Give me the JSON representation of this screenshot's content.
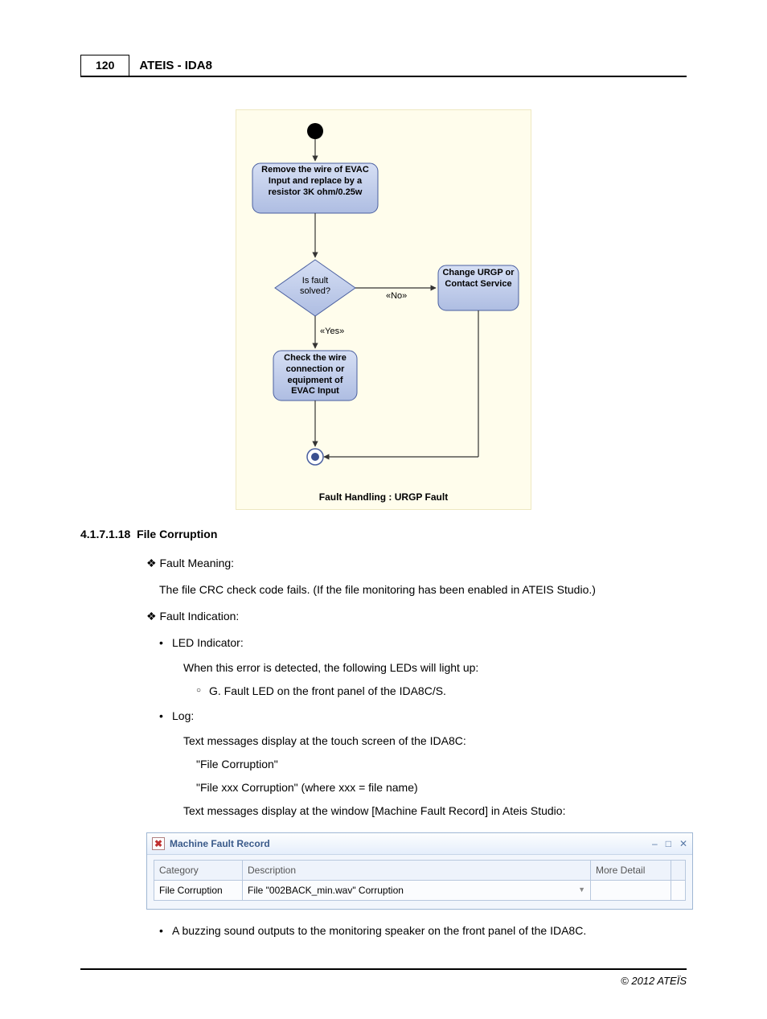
{
  "header": {
    "page_number": "120",
    "title": "ATEIS - IDA8"
  },
  "flowchart": {
    "start": "",
    "step1": "Remove the wire of EVAC Input and replace by a resistor 3K ohm/0.25w",
    "decision": "Is fault solved?",
    "yes_label": "«Yes»",
    "no_label": "«No»",
    "right_box": "Change URGP or Contact Service",
    "step2": "Check the wire connection or equipment of EVAC Input",
    "caption": "Fault Handling : URGP Fault"
  },
  "section": {
    "number": "4.1.7.1.18",
    "title": "File Corruption"
  },
  "body": {
    "fault_meaning_h": "Fault Meaning:",
    "fault_meaning_text": "The file CRC check code fails. (If the file monitoring has been enabled in ATEIS Studio.)",
    "fault_indication_h": "Fault Indication:",
    "led_h": "LED Indicator:",
    "led_text": "When this error is detected, the following LEDs will light up:",
    "led_item": "G. Fault LED on the front panel of the IDA8C/S.",
    "log_h": "Log:",
    "log_text1": "Text messages display at the touch screen of the IDA8C:",
    "log_q1": "\"File Corruption\"",
    "log_q2": "\"File xxx Corruption\" (where xxx = file name)",
    "log_text2": "Text messages display at the window [Machine Fault Record] in Ateis Studio:",
    "buzz": "A buzzing sound outputs to the monitoring speaker on the front panel of the IDA8C."
  },
  "mfr": {
    "title": "Machine Fault Record",
    "cols": {
      "category": "Category",
      "description": "Description",
      "more": "More Detail"
    },
    "row": {
      "category": "File Corruption",
      "description": "File \"002BACK_min.wav\" Corruption"
    },
    "ctrl_min": "–",
    "ctrl_max": "□",
    "ctrl_close": "✕"
  },
  "footer": "© 2012 ATEÏS"
}
